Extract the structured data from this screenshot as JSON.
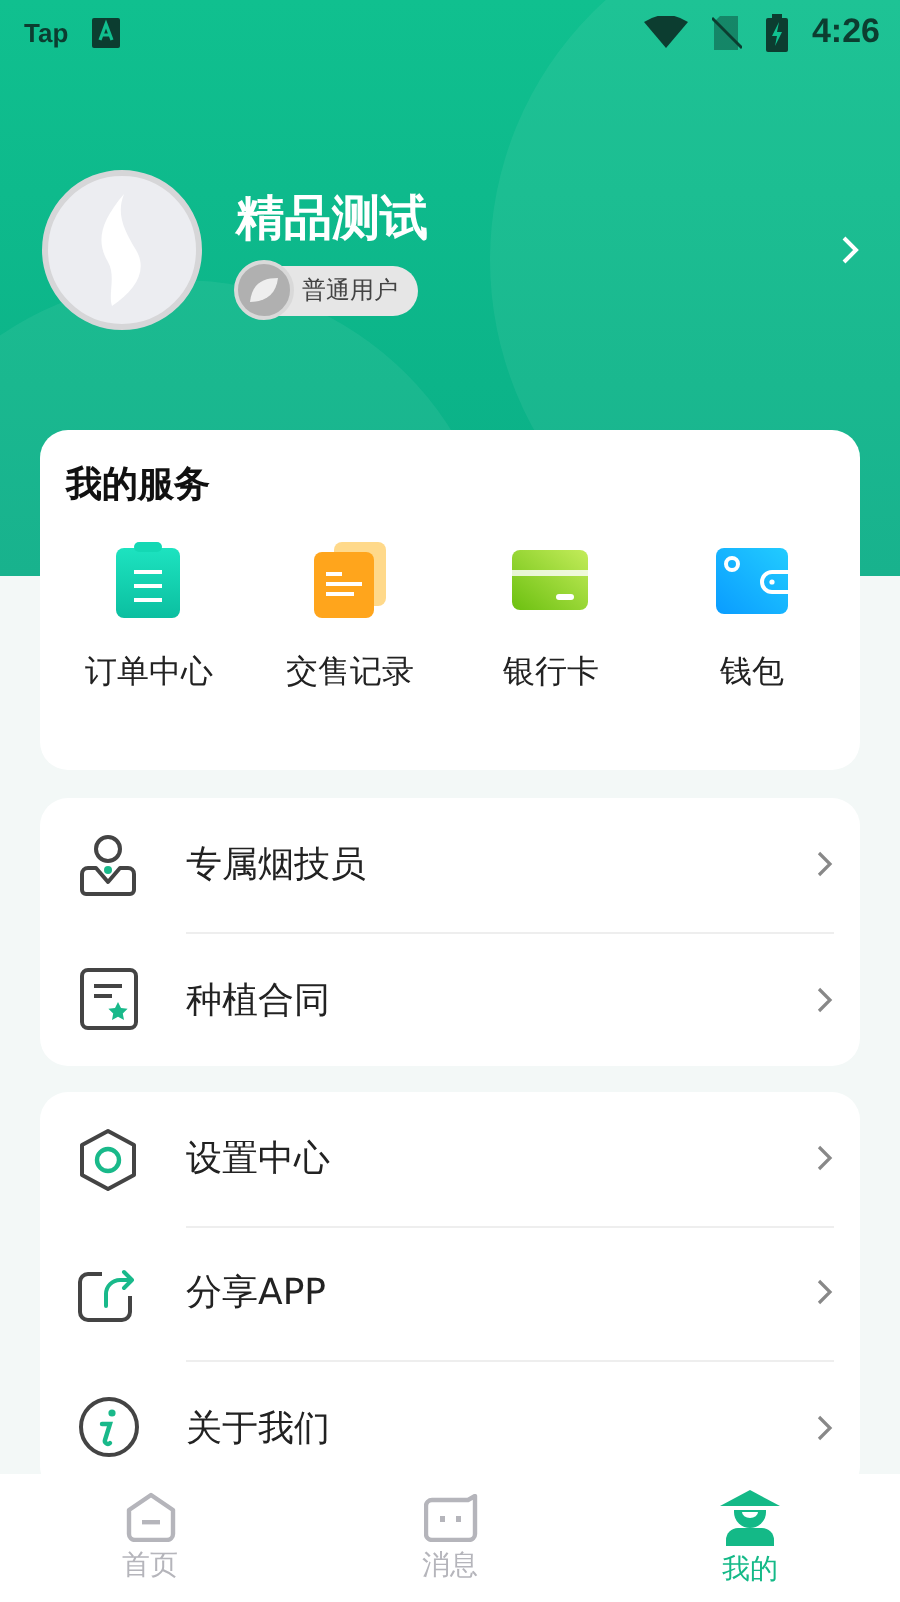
{
  "status_bar": {
    "app_label": "Tap",
    "time": "4:26"
  },
  "profile": {
    "name": "精品测试",
    "badge": "普通用户"
  },
  "services": {
    "title": "我的服务",
    "items": [
      {
        "kind": "orders",
        "label": "订单中心"
      },
      {
        "kind": "records",
        "label": "交售记录"
      },
      {
        "kind": "card",
        "label": "银行卡"
      },
      {
        "kind": "wallet",
        "label": "钱包"
      }
    ]
  },
  "menu_groups": [
    [
      {
        "kind": "technician",
        "label": "专属烟技员"
      },
      {
        "kind": "contract",
        "label": "种植合同"
      }
    ],
    [
      {
        "kind": "settings",
        "label": "设置中心"
      },
      {
        "kind": "share",
        "label": "分享APP"
      },
      {
        "kind": "about",
        "label": "关于我们"
      }
    ]
  ],
  "tabs": [
    {
      "kind": "home",
      "label": "首页",
      "selected": false
    },
    {
      "kind": "messages",
      "label": "消息",
      "selected": false
    },
    {
      "kind": "me",
      "label": "我的",
      "selected": true
    }
  ]
}
